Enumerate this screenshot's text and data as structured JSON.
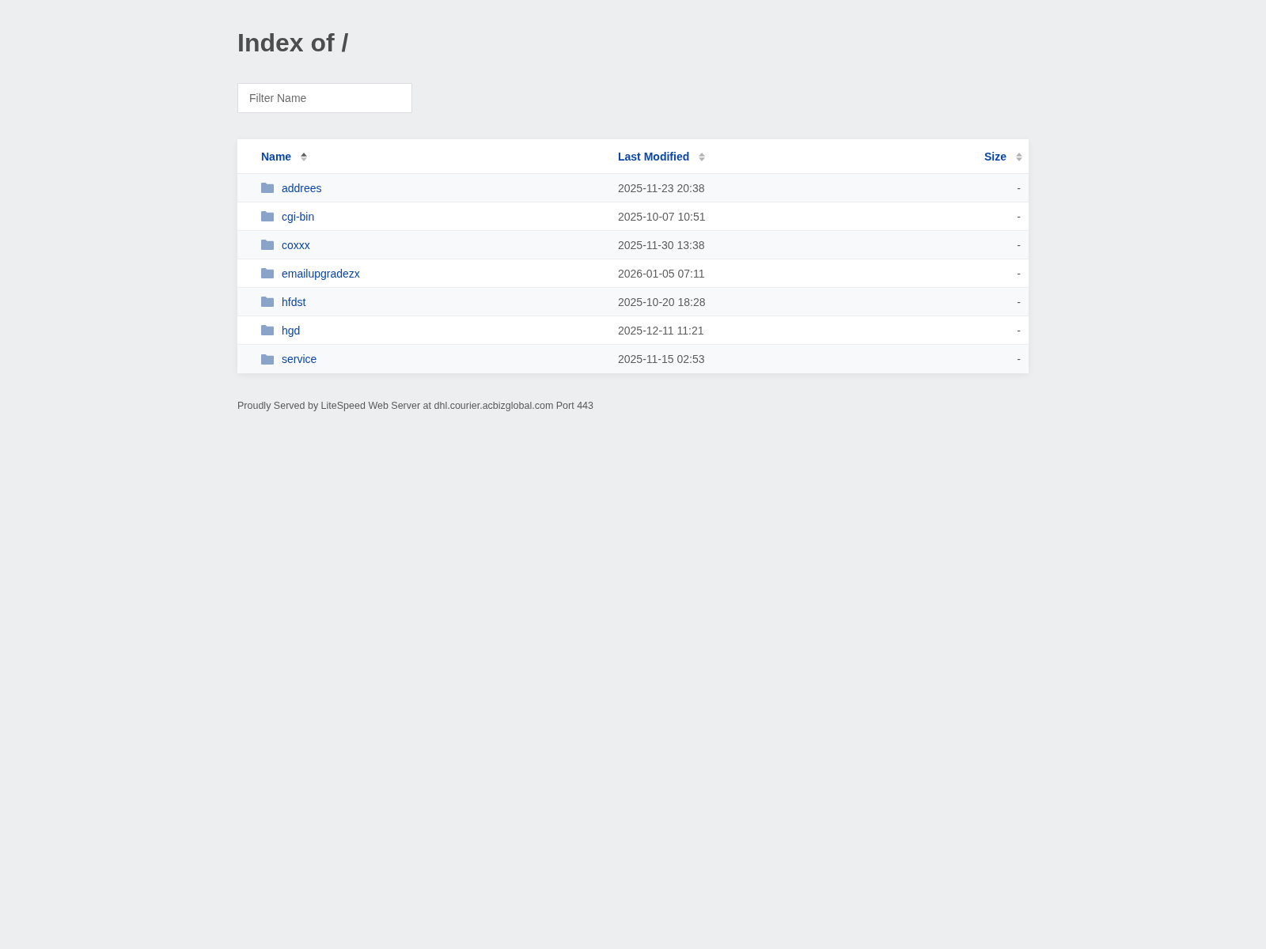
{
  "page": {
    "title": "Index of /"
  },
  "filter": {
    "placeholder": "Filter Name"
  },
  "table": {
    "columns": [
      {
        "label": "Name",
        "sorted": true
      },
      {
        "label": "Last Modified",
        "sorted": false
      },
      {
        "label": "Size",
        "sorted": false
      }
    ],
    "rows": [
      {
        "kind": "folder",
        "name": "addrees",
        "modified": "2025-11-23 20:38",
        "size": "-"
      },
      {
        "kind": "folder",
        "name": "cgi-bin",
        "modified": "2025-10-07 10:51",
        "size": "-"
      },
      {
        "kind": "folder",
        "name": "coxxx",
        "modified": "2025-11-30 13:38",
        "size": "-"
      },
      {
        "kind": "folder",
        "name": "emailupgradezx",
        "modified": "2026-01-05 07:11",
        "size": "-"
      },
      {
        "kind": "folder",
        "name": "hfdst",
        "modified": "2025-10-20 18:28",
        "size": "-"
      },
      {
        "kind": "folder",
        "name": "hgd",
        "modified": "2025-12-11 11:21",
        "size": "-"
      },
      {
        "kind": "folder",
        "name": "service",
        "modified": "2025-11-15 02:53",
        "size": "-"
      }
    ]
  },
  "footer": {
    "text": "Proudly Served by LiteSpeed Web Server at dhl.courier.acbizglobal.com Port 443"
  }
}
